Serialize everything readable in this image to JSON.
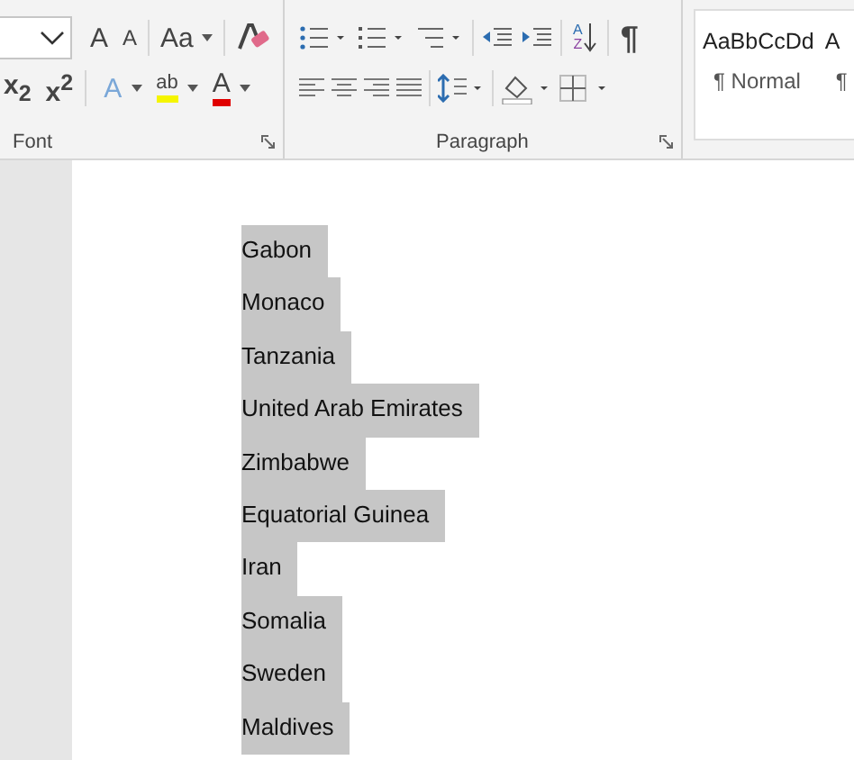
{
  "ribbon": {
    "font_group": {
      "label": "Font",
      "grow_font": "A",
      "shrink_font": "A",
      "change_case": "Aa",
      "subscript": "x$_{2}$",
      "superscript": "x$^{2}$",
      "text_effects": "A",
      "highlight": "ab",
      "font_color": "A"
    },
    "paragraph_group": {
      "label": "Paragraph",
      "sort_top": "A",
      "sort_bottom": "Z",
      "pilcrow": "¶"
    },
    "styles": [
      {
        "preview": "AaBbCcDd",
        "name": "¶ Normal"
      },
      {
        "preview": "A",
        "name": "¶"
      }
    ]
  },
  "document": {
    "lines": [
      {
        "text": "Gabon",
        "selected": true
      },
      {
        "text": "Monaco",
        "selected": true
      },
      {
        "text": "Tanzania",
        "selected": true
      },
      {
        "text": "United Arab Emirates",
        "selected": true
      },
      {
        "text": "Zimbabwe",
        "selected": true
      },
      {
        "text": "Equatorial Guinea",
        "selected": true
      },
      {
        "text": "Iran",
        "selected": true
      },
      {
        "text": "Somalia",
        "selected": true
      },
      {
        "text": "Sweden",
        "selected": true
      },
      {
        "text": "Maldives",
        "selected": true
      }
    ]
  }
}
